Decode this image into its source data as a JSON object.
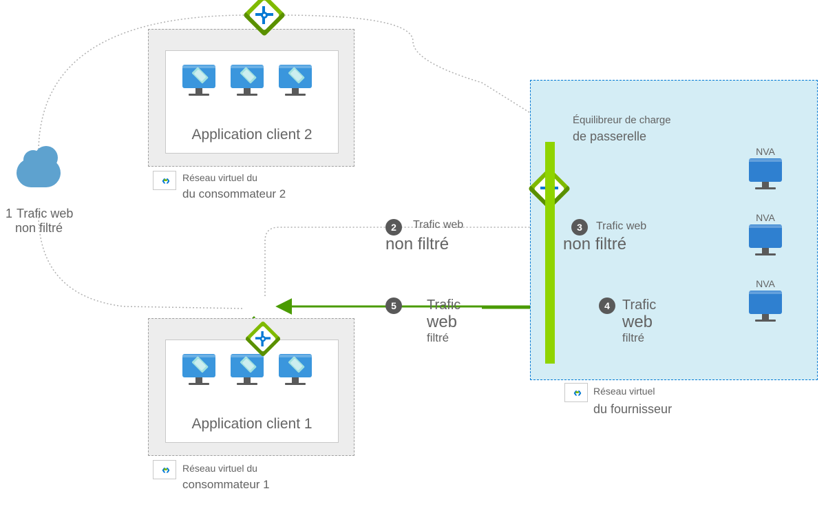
{
  "cloud": {
    "step": "1",
    "label_line1": "Trafic web",
    "label_line2": "non filtré"
  },
  "consumer2": {
    "app_label": "Application client 2",
    "vnet_line1": "Réseau virtuel du",
    "vnet_line2": "du consommateur 2"
  },
  "consumer1": {
    "app_label": "Application client 1",
    "vnet_line1": "Réseau virtuel du",
    "vnet_line2": "consommateur 1"
  },
  "provider": {
    "lb_line1": "Équilibreur de charge",
    "lb_line2": "de passerelle",
    "nva_label": "NVA",
    "vnet_line1": "Réseau virtuel",
    "vnet_line2": "du fournisseur"
  },
  "flows": {
    "step2": {
      "num": "2",
      "line1": "Trafic web",
      "line2": "non filtré"
    },
    "step3": {
      "num": "3",
      "line1": "Trafic web",
      "line2": "non filtré"
    },
    "step4": {
      "num": "4",
      "line1": "Trafic",
      "line2": "web",
      "line3": "filtré"
    },
    "step5": {
      "num": "5",
      "line1": "Trafic",
      "line2": "web",
      "line3": "filtré"
    }
  }
}
